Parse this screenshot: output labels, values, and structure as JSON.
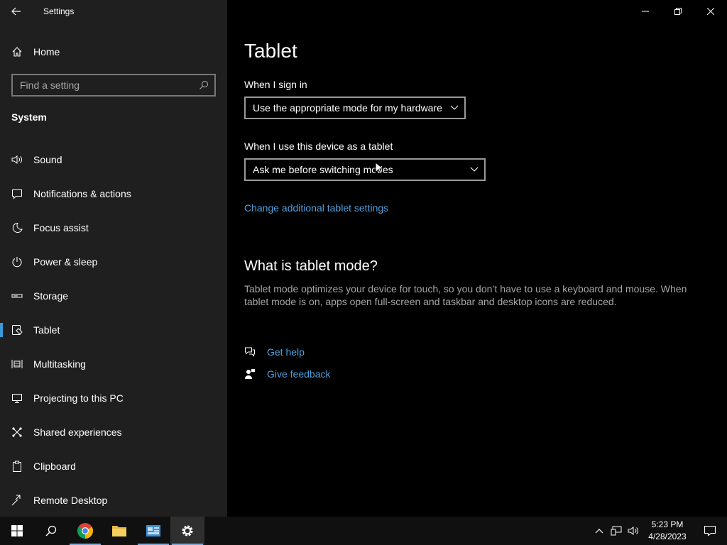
{
  "window": {
    "title": "Settings"
  },
  "sidebar": {
    "home_label": "Home",
    "search_placeholder": "Find a setting",
    "section_title": "System",
    "items": [
      {
        "label": "Sound",
        "icon": "speaker-icon"
      },
      {
        "label": "Notifications & actions",
        "icon": "message-icon"
      },
      {
        "label": "Focus assist",
        "icon": "moon-icon"
      },
      {
        "label": "Power & sleep",
        "icon": "power-icon"
      },
      {
        "label": "Storage",
        "icon": "storage-icon"
      },
      {
        "label": "Tablet",
        "icon": "tablet-icon",
        "active": true
      },
      {
        "label": "Multitasking",
        "icon": "multitasking-icon"
      },
      {
        "label": "Projecting to this PC",
        "icon": "projecting-icon"
      },
      {
        "label": "Shared experiences",
        "icon": "shared-icon"
      },
      {
        "label": "Clipboard",
        "icon": "clipboard-icon"
      },
      {
        "label": "Remote Desktop",
        "icon": "remote-desktop-icon"
      }
    ]
  },
  "main": {
    "title": "Tablet",
    "signin_label": "When I sign in",
    "signin_value": "Use the appropriate mode for my hardware",
    "tablet_label": "When I use this device as a tablet",
    "tablet_value": "Ask me before switching modes",
    "additional_link": "Change additional tablet settings",
    "what_title": "What is tablet mode?",
    "what_desc": "Tablet mode optimizes your device for touch, so you don’t have to use a keyboard and mouse. When tablet mode is on, apps open full-screen and taskbar and desktop icons are reduced.",
    "get_help": "Get help",
    "give_feedback": "Give feedback"
  },
  "taskbar": {
    "time": "5:23 PM",
    "date": "4/28/2023"
  },
  "colors": {
    "accent": "#3a9ad9",
    "link": "#4ea1e0",
    "sidebar_bg": "#1f1f1f"
  }
}
